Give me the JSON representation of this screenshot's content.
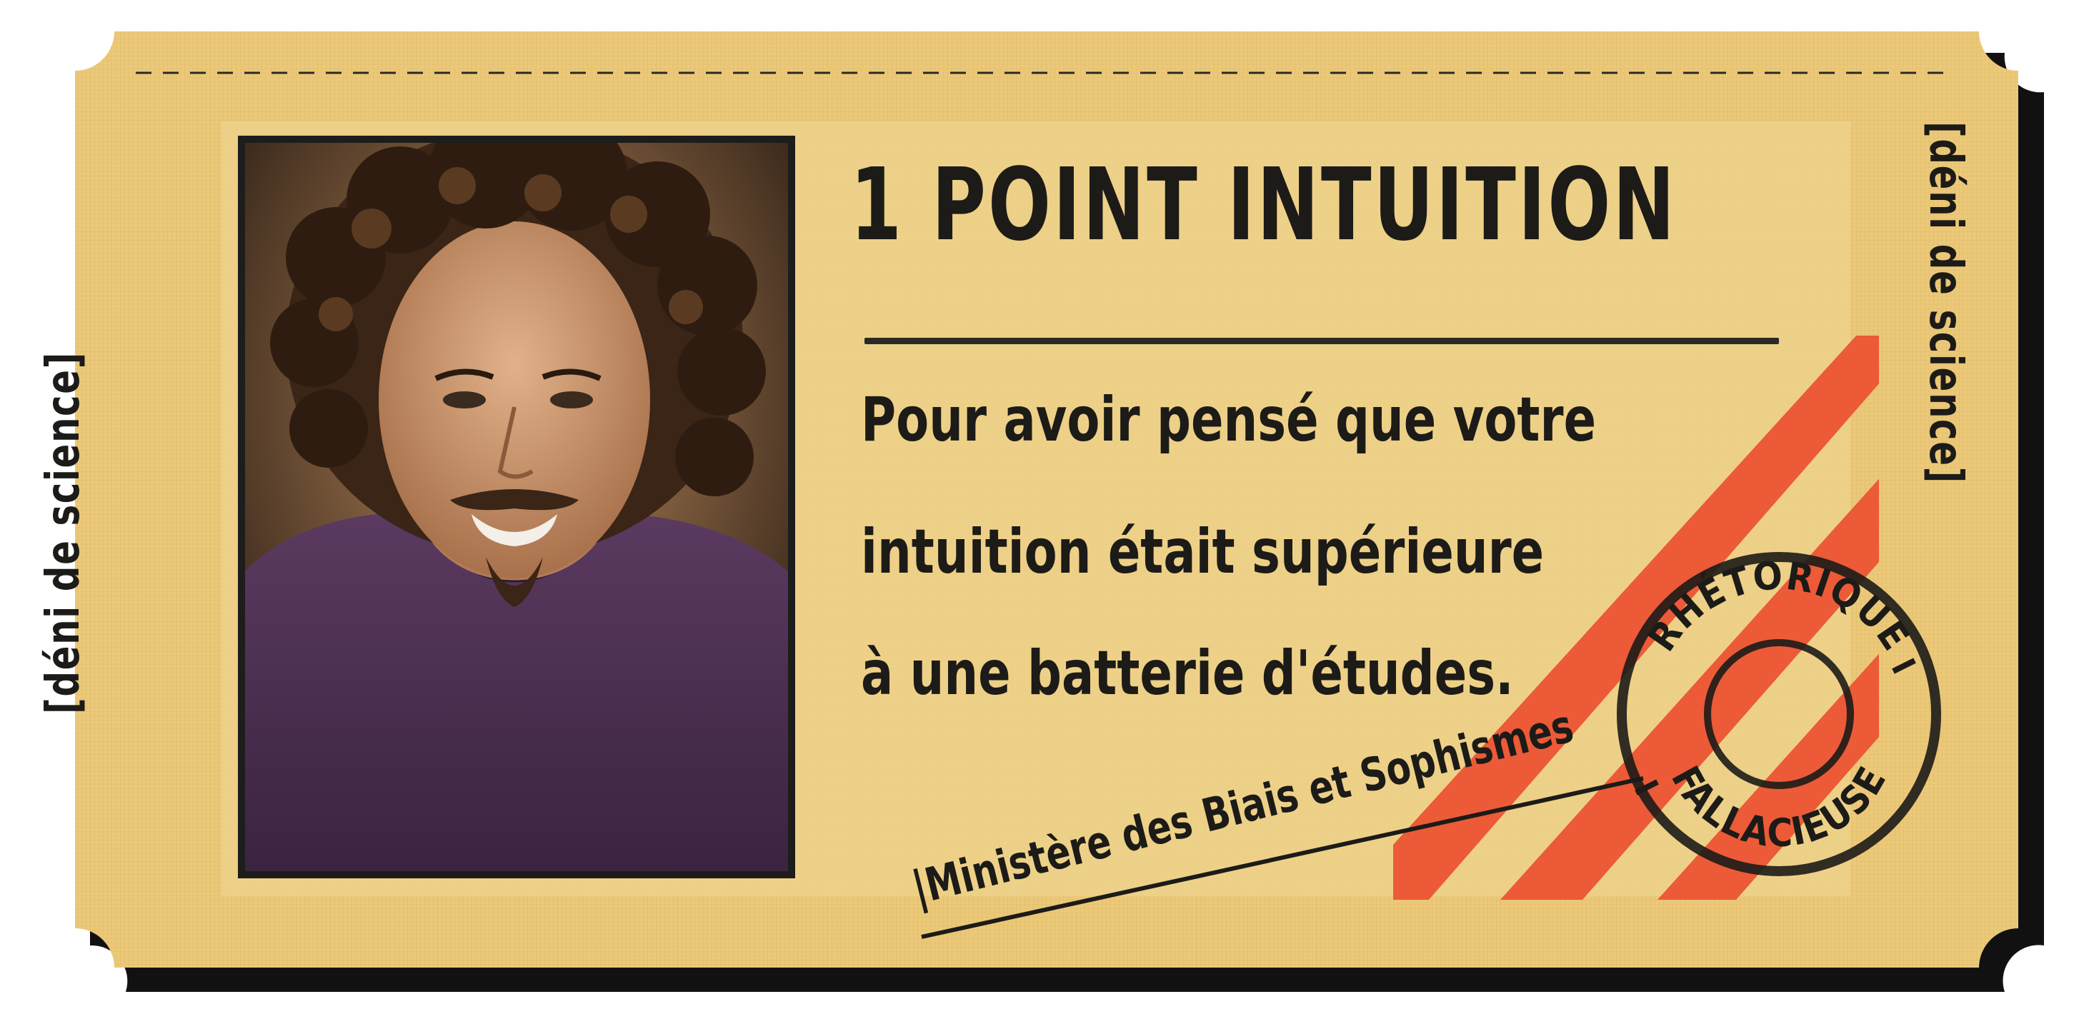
{
  "ticket": {
    "title": "1 POINT INTUITION",
    "body_lines": [
      "Pour avoir pensé que votre",
      "intuition était supérieure",
      "à une batterie d'études."
    ],
    "side_label_left": "[déni de science]",
    "side_label_right": "[déni de science]",
    "ministry": "|Ministère des Biais et Sophismes",
    "stamp": {
      "top_text": "RHÉTORIQUE",
      "bottom_text": "FALLACIEUSE"
    }
  },
  "colors": {
    "ticket_fill": "#ecc979",
    "inner_panel": "#f0d48f",
    "ink": "#1c1b18",
    "stripes": "#ec5a37",
    "photo_border": "#1d1d1b"
  }
}
